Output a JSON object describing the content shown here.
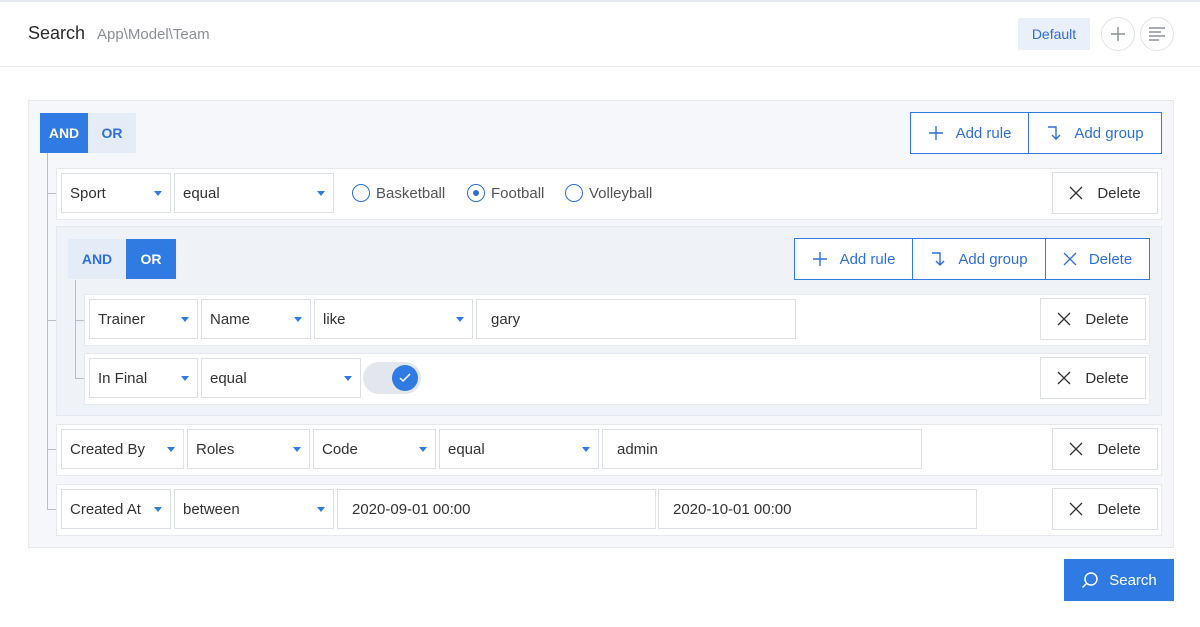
{
  "header": {
    "title": "Search",
    "subtitle": "App\\Model\\Team",
    "default_label": "Default"
  },
  "group1": {
    "and_label": "AND",
    "or_label": "OR",
    "active": "AND",
    "add_rule_label": "Add rule",
    "add_group_label": "Add group"
  },
  "rule_sport": {
    "field": "Sport",
    "operator": "equal",
    "options": [
      "Basketball",
      "Football",
      "Volleyball"
    ],
    "selected": "Football",
    "delete_label": "Delete"
  },
  "group2": {
    "and_label": "AND",
    "or_label": "OR",
    "active": "OR",
    "add_rule_label": "Add rule",
    "add_group_label": "Add group",
    "delete_label": "Delete"
  },
  "rule_trainer": {
    "field": "Trainer",
    "subfield": "Name",
    "operator": "like",
    "value": "gary",
    "delete_label": "Delete"
  },
  "rule_final": {
    "field": "In Final",
    "operator": "equal",
    "value": true,
    "delete_label": "Delete"
  },
  "rule_created_by": {
    "field": "Created By",
    "subfield": "Roles",
    "subfield2": "Code",
    "operator": "equal",
    "value": "admin",
    "delete_label": "Delete"
  },
  "rule_created_at": {
    "field": "Created At",
    "operator": "between",
    "value_from": "2020-09-01 00:00",
    "value_to": "2020-10-01 00:00",
    "delete_label": "Delete"
  },
  "footer": {
    "search_label": "Search"
  },
  "colors": {
    "accent": "#2f7be3",
    "accent_light": "#e4ecf8"
  },
  "icons": {
    "plus": "plus-icon",
    "menu": "menu-lines-icon",
    "add_group": "arrow-down-right-icon",
    "delete": "close-icon",
    "search": "search-icon",
    "check": "check-icon"
  }
}
